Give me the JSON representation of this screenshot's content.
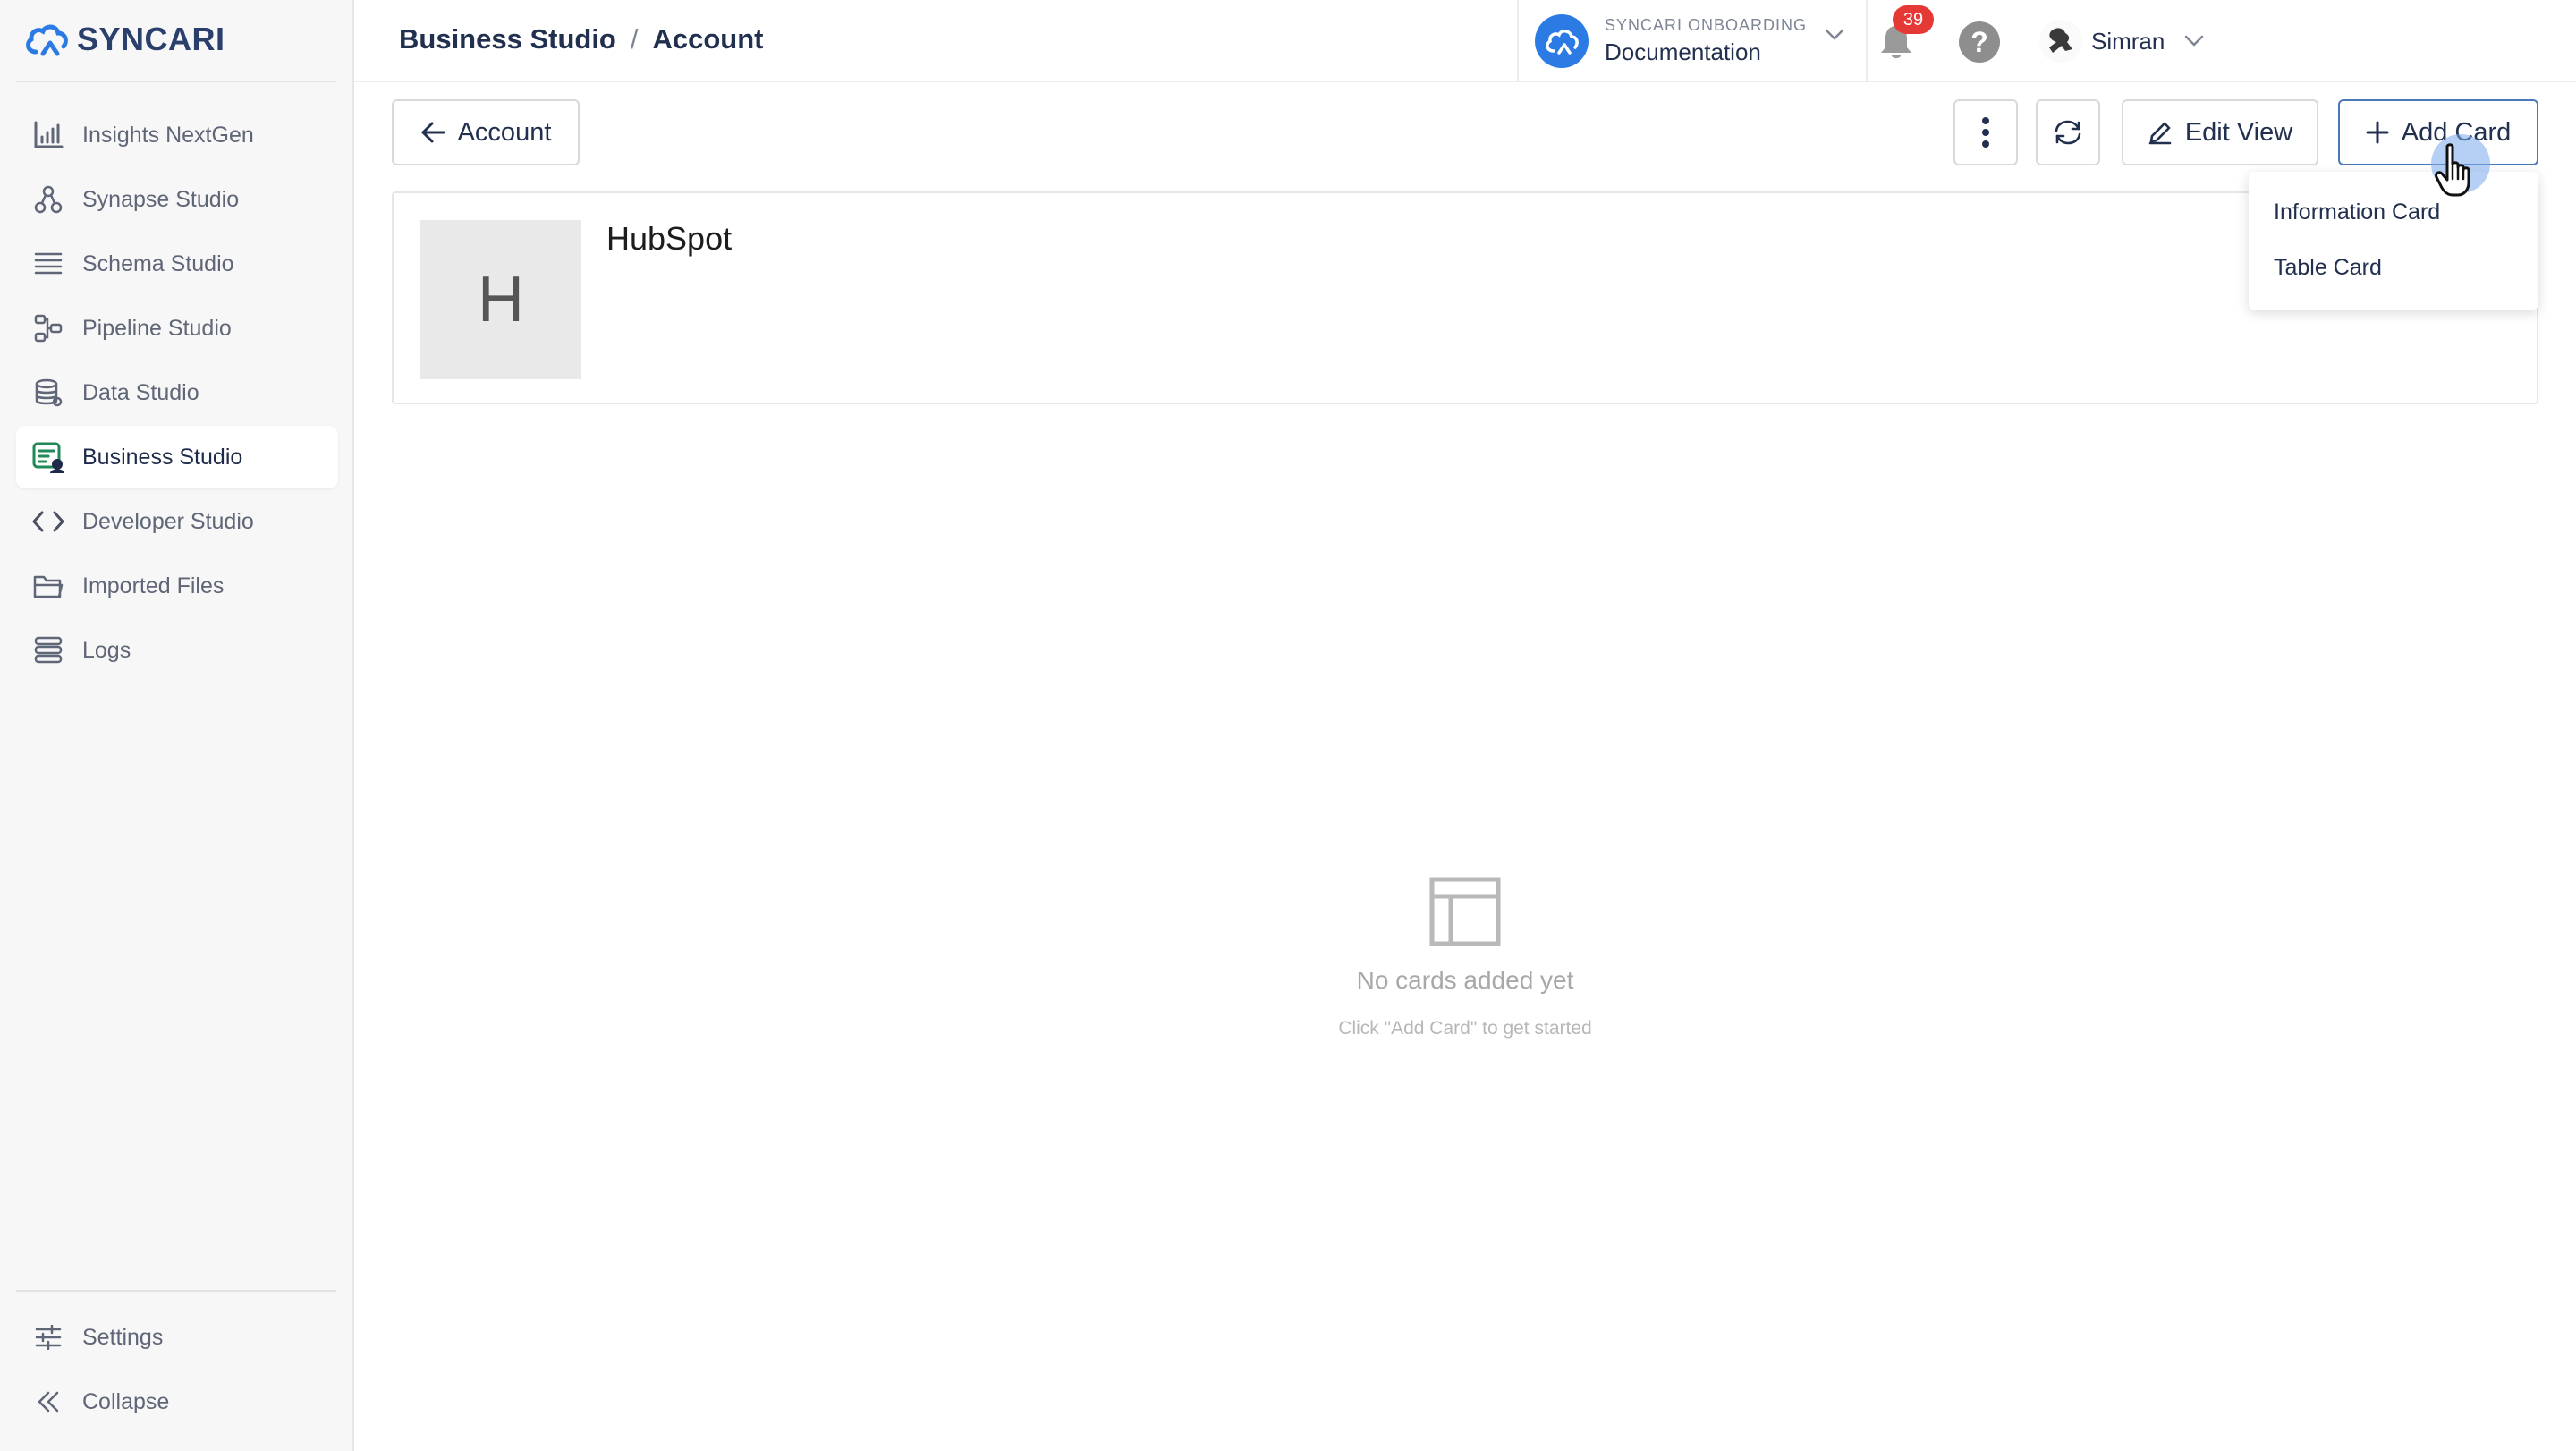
{
  "app": {
    "logo_text": "SYNCARI",
    "accent_color": "#2c7be5"
  },
  "sidebar": {
    "items": [
      {
        "label": "Insights NextGen",
        "icon": "bar-chart-icon"
      },
      {
        "label": "Synapse Studio",
        "icon": "nodes-icon"
      },
      {
        "label": "Schema Studio",
        "icon": "list-icon"
      },
      {
        "label": "Pipeline Studio",
        "icon": "pipeline-icon"
      },
      {
        "label": "Data Studio",
        "icon": "database-icon"
      },
      {
        "label": "Business Studio",
        "icon": "business-icon",
        "active": true
      },
      {
        "label": "Developer Studio",
        "icon": "code-icon"
      },
      {
        "label": "Imported Files",
        "icon": "folder-icon"
      },
      {
        "label": "Logs",
        "icon": "logs-icon"
      }
    ],
    "bottom": {
      "settings": "Settings",
      "collapse": "Collapse"
    }
  },
  "header": {
    "breadcrumb": [
      "Business Studio",
      "Account"
    ],
    "org": {
      "label": "SYNCARI ONBOARDING",
      "name": "Documentation"
    },
    "notifications_count": "39",
    "help": "?",
    "user_name": "Simran"
  },
  "toolbar": {
    "back_label": "Account",
    "edit_label": "Edit View",
    "add_label": "Add Card"
  },
  "record": {
    "avatar_letter": "H",
    "title": "HubSpot"
  },
  "add_card_menu": {
    "items": [
      "Information Card",
      "Table Card"
    ]
  },
  "empty_state": {
    "title": "No cards added yet",
    "subtitle": "Click \"Add Card\" to get started"
  }
}
